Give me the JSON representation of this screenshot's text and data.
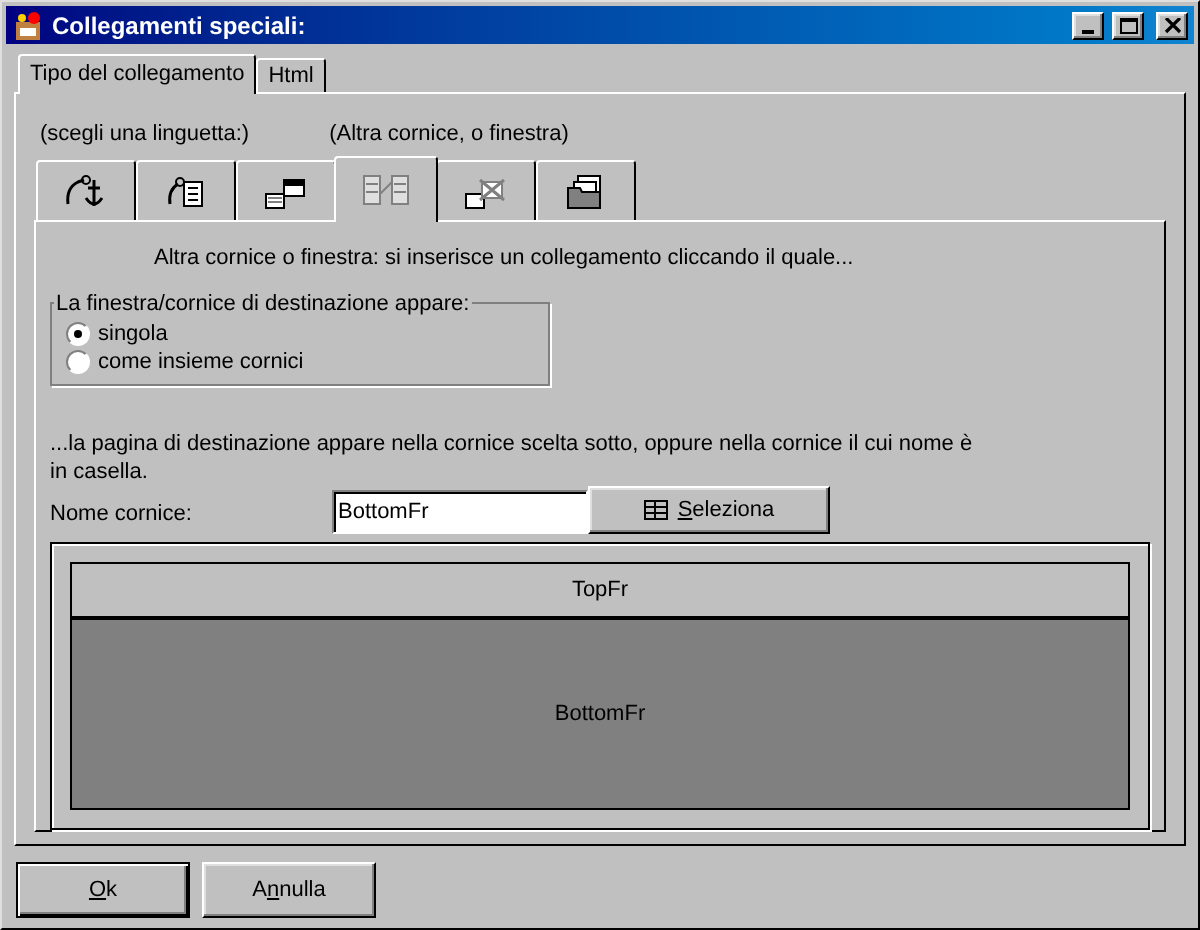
{
  "window": {
    "title": "Collegamenti speciali:"
  },
  "tabs": [
    {
      "label": "Tipo del collegamento",
      "selected": true
    },
    {
      "label": "Html",
      "selected": false
    }
  ],
  "hint": "(scegli una linguetta:)",
  "current_type": "(Altra cornice, o finestra)",
  "link_types": [
    {
      "kind": "anchor",
      "selected": false
    },
    {
      "kind": "file",
      "selected": false
    },
    {
      "kind": "window",
      "selected": false
    },
    {
      "kind": "frame",
      "selected": true
    },
    {
      "kind": "close",
      "selected": false
    },
    {
      "kind": "folder",
      "selected": false
    }
  ],
  "description": "Altra cornice o finestra: si inserisce un collegamento cliccando il quale...",
  "target_group": {
    "legend": "La finestra/cornice di destinazione appare:",
    "options": [
      {
        "label": "singola",
        "selected": true
      },
      {
        "label": "come insieme cornici",
        "selected": false
      }
    ]
  },
  "note": "...la pagina di destinazione appare nella cornice scelta sotto, oppure nella cornice il cui nome è in casella.",
  "frame_name": {
    "label": "Nome cornice:",
    "value": "BottomFr"
  },
  "select_button": {
    "label_parts": [
      {
        "text": "S",
        "underlined": true
      },
      {
        "text": "eleziona",
        "underlined": false
      }
    ]
  },
  "frames": [
    {
      "name": "TopFr",
      "selected": false
    },
    {
      "name": "BottomFr",
      "selected": true
    }
  ],
  "buttons": [
    {
      "label_parts": [
        {
          "text": "O",
          "underlined": true
        },
        {
          "text": "k",
          "underlined": false
        }
      ]
    },
    {
      "label_parts": [
        {
          "text": "A",
          "underlined": false
        },
        {
          "text": "n",
          "underlined": true
        },
        {
          "text": "nulla",
          "underlined": false
        }
      ]
    }
  ]
}
